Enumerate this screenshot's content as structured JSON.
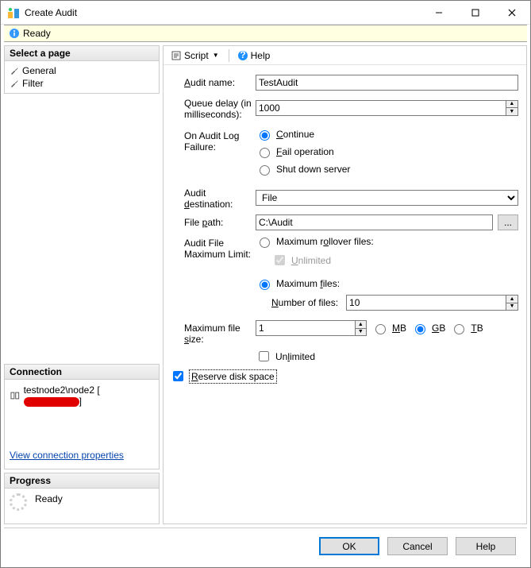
{
  "window": {
    "title": "Create Audit"
  },
  "status": {
    "text": "Ready"
  },
  "sidebar": {
    "pages_header": "Select a page",
    "pages": [
      {
        "label": "General"
      },
      {
        "label": "Filter"
      }
    ],
    "connection_header": "Connection",
    "connection_text_prefix": "testnode2\\node2 [",
    "connection_text_suffix": "]",
    "view_conn_link": "View connection properties",
    "progress_header": "Progress",
    "progress_text": "Ready"
  },
  "toolbar": {
    "script": "Script",
    "help": "Help"
  },
  "form": {
    "audit_name_label": "Audit name:",
    "audit_name_value": "TestAudit",
    "queue_delay_label": "Queue delay (in milliseconds):",
    "queue_delay_value": "1000",
    "on_failure_label": "On Audit Log Failure:",
    "on_failure_options": {
      "continue": "Continue",
      "fail": "Fail operation",
      "shutdown": "Shut down server"
    },
    "destination_label": "Audit destination:",
    "destination_value": "File",
    "path_label": "Path:",
    "path_value": "C:\\Audit",
    "browse_label": "...",
    "max_limit_label": "Audit File Maximum Limit:",
    "max_rollover_label": "Maximum rollover files:",
    "unlimited_label": "Unlimited",
    "max_files_label": "Maximum files:",
    "num_files_label": "Number of files:",
    "num_files_value": "10",
    "max_size_label": "Maximum file size:",
    "max_size_value": "1",
    "size_units": {
      "mb": "MB",
      "gb": "GB",
      "tb": "TB"
    },
    "size_unlimited": "Unlimited",
    "reserve_label": "Reserve disk space"
  },
  "buttons": {
    "ok": "OK",
    "cancel": "Cancel",
    "help": "Help"
  }
}
